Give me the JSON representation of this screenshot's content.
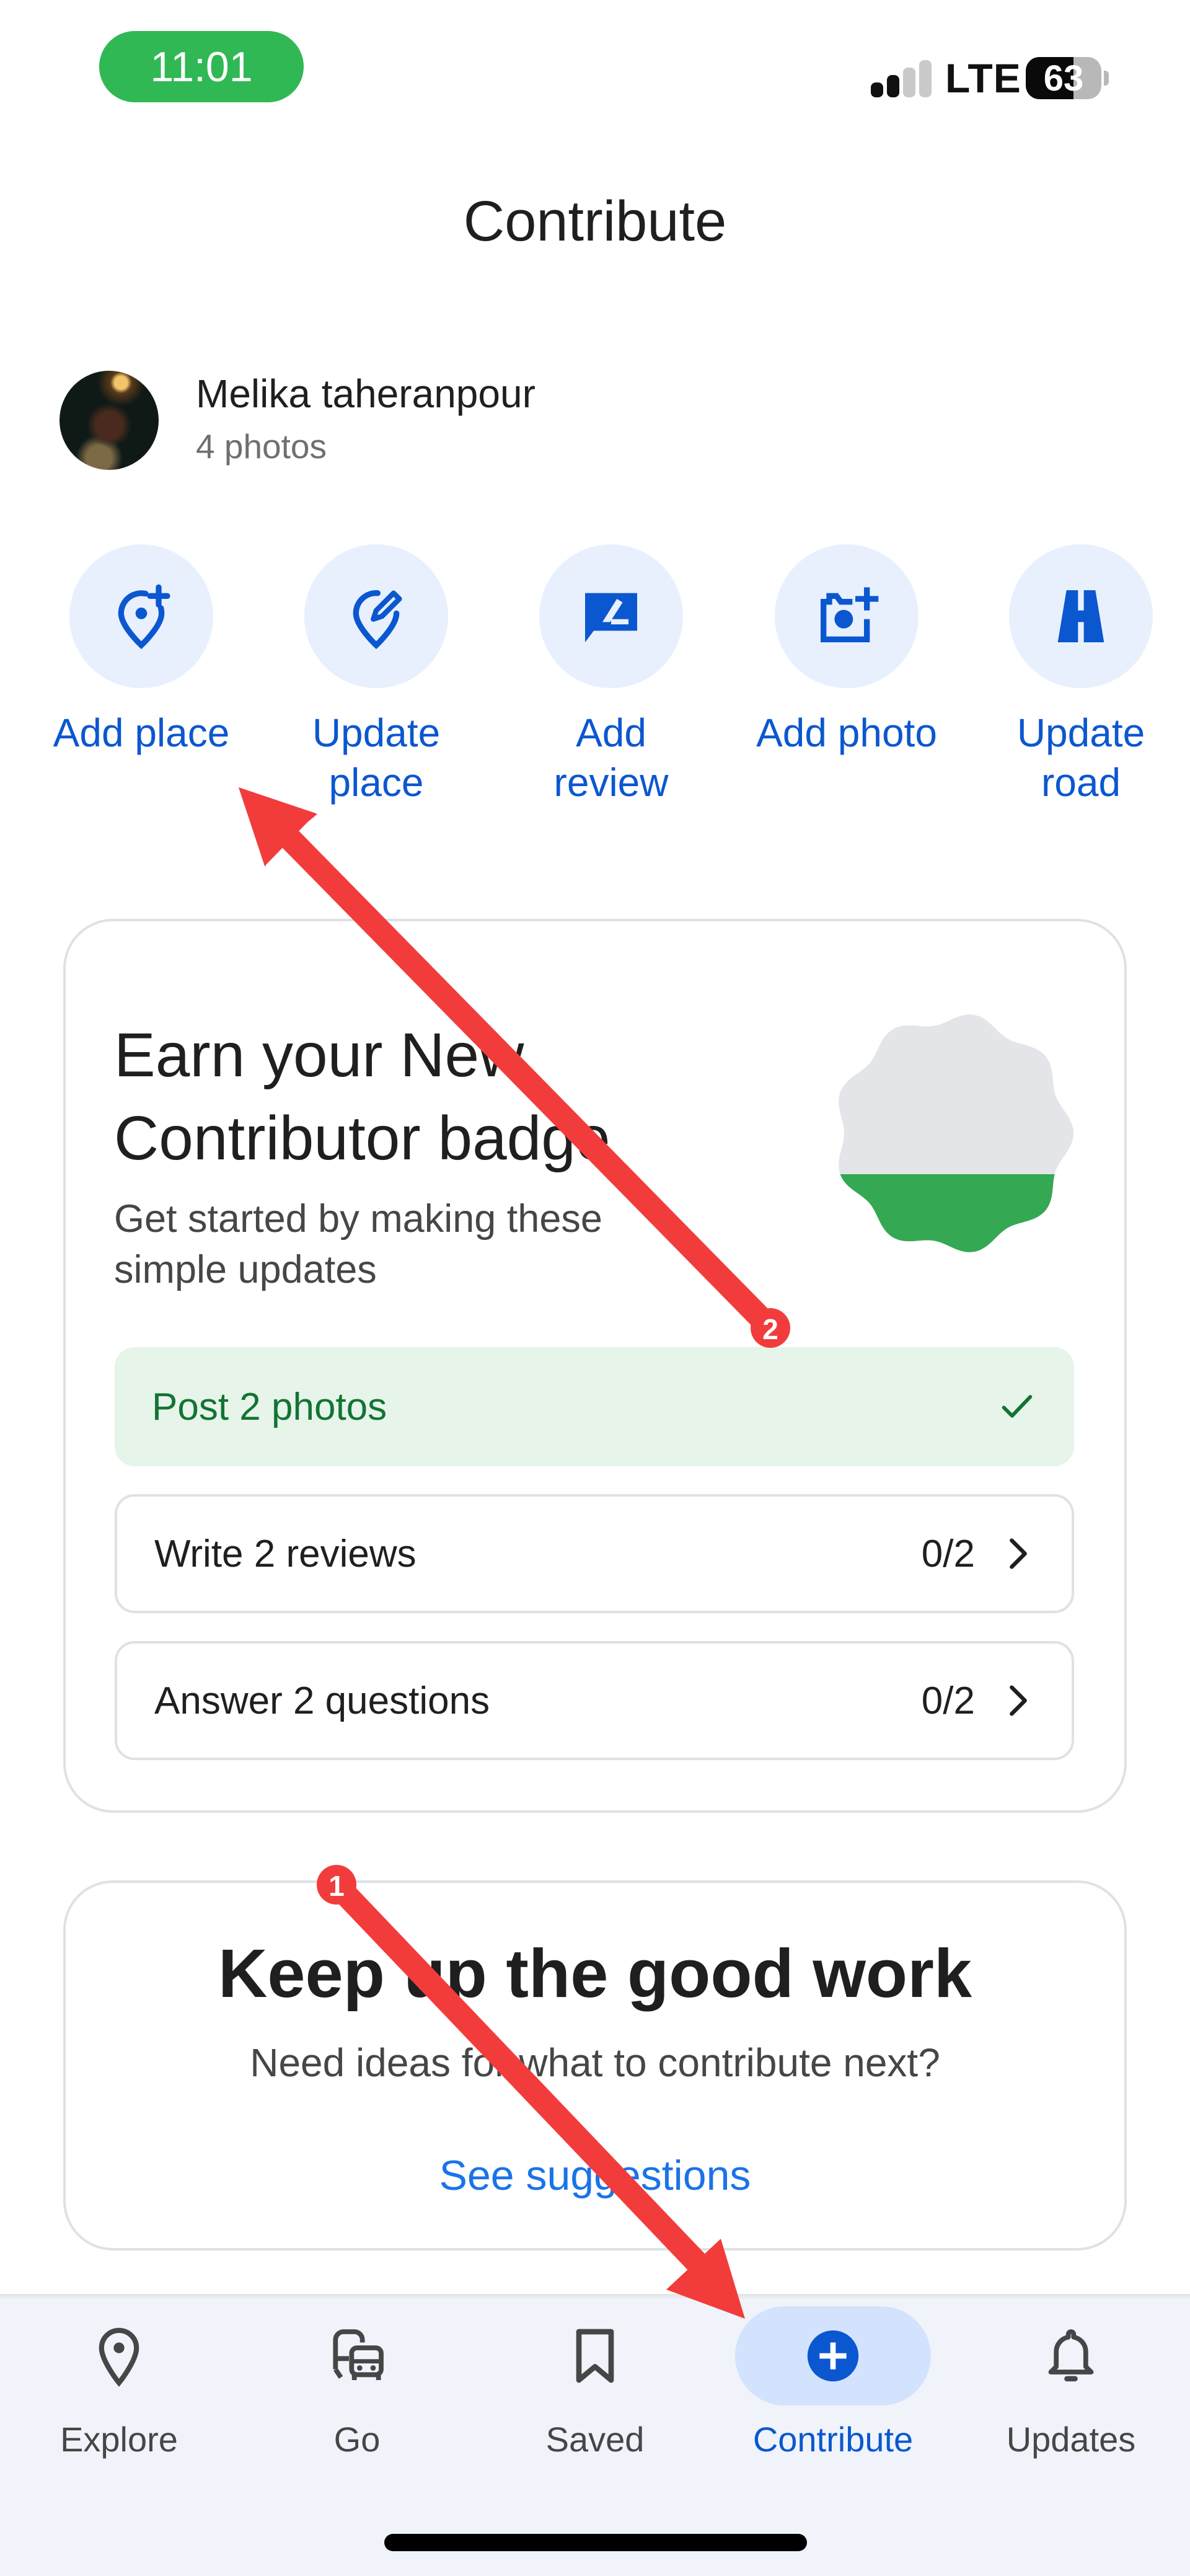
{
  "status_bar": {
    "time": "11:01",
    "network": "LTE",
    "battery_percent": "63",
    "battery_level": 0.63,
    "signal_bars_active": 2,
    "signal_bars_total": 4,
    "time_pill_color": "#30b854"
  },
  "header": {
    "title": "Contribute"
  },
  "profile": {
    "name": "Melika taheranpour",
    "subtitle": "4 photos"
  },
  "actions": [
    {
      "icon": "add-place-icon",
      "label_line1": "Add place",
      "label_line2": ""
    },
    {
      "icon": "update-place-icon",
      "label_line1": "Update",
      "label_line2": "place"
    },
    {
      "icon": "add-review-icon",
      "label_line1": "Add",
      "label_line2": "review"
    },
    {
      "icon": "add-photo-icon",
      "label_line1": "Add photo",
      "label_line2": ""
    },
    {
      "icon": "update-road-icon",
      "label_line1": "Update",
      "label_line2": "road"
    }
  ],
  "badge_card": {
    "title_line1": "Earn your New",
    "title_line2": "Contributor badge",
    "subtitle_line1": "Get started by making these",
    "subtitle_line2": "simple updates",
    "badge_progress": 0.33,
    "badge_colors": {
      "empty": "#e3e5e8",
      "filled": "#34a853"
    },
    "tasks": [
      {
        "label": "Post 2 photos",
        "count": "",
        "status": "done",
        "icon": "check-icon"
      },
      {
        "label": "Write 2 reviews",
        "count": "0/2",
        "status": "open",
        "icon": "chevron-right-icon"
      },
      {
        "label": "Answer 2 questions",
        "count": "0/2",
        "status": "open",
        "icon": "chevron-right-icon"
      }
    ]
  },
  "keep_card": {
    "title": "Keep up the good work",
    "subtitle": "Need ideas for what to contribute next?",
    "link": "See suggestions"
  },
  "bottom_nav": {
    "items": [
      {
        "label": "Explore",
        "icon": "location-pin-icon",
        "active": false
      },
      {
        "label": "Go",
        "icon": "commute-icon",
        "active": false
      },
      {
        "label": "Saved",
        "icon": "bookmark-icon",
        "active": false
      },
      {
        "label": "Contribute",
        "icon": "add-circle-icon",
        "active": true
      },
      {
        "label": "Updates",
        "icon": "bell-icon",
        "active": false
      }
    ]
  },
  "annotations": [
    {
      "number": "1",
      "color": "#f23c3c",
      "points_to": "Contribute tab"
    },
    {
      "number": "2",
      "color": "#f23c3c",
      "points_to": "Add place"
    }
  ],
  "colors": {
    "accent_blue": "#0b57d0",
    "link_blue": "#1a73e8",
    "success_green": "#137333",
    "success_bg": "#e6f4ea",
    "nav_bg": "#f0f4fa"
  }
}
